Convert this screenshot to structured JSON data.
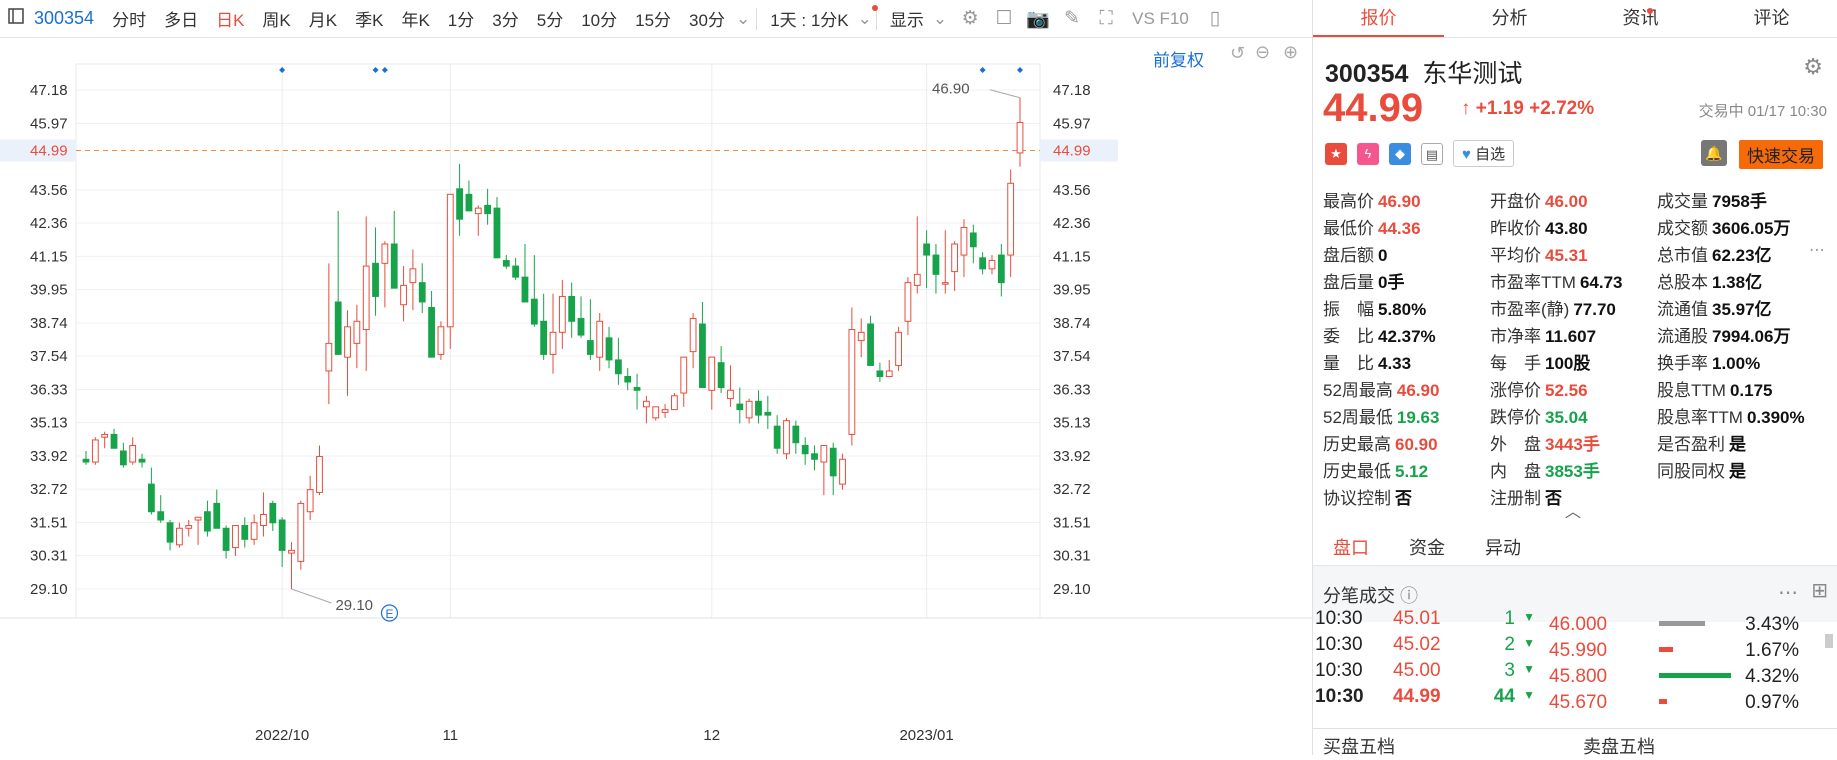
{
  "toolbar": {
    "code": "300354",
    "items": [
      "分时",
      "多日",
      "日K",
      "周K",
      "月K",
      "季K",
      "年K",
      "1分",
      "3分",
      "5分",
      "10分",
      "15分",
      "30分"
    ],
    "active": "日K",
    "range": "1天 : 1分K",
    "display": "显示",
    "vs": "VS F10"
  },
  "chart": {
    "restore": "前复权",
    "yticks": [
      "47.18",
      "45.97",
      "44.99",
      "43.56",
      "42.36",
      "41.15",
      "39.95",
      "38.74",
      "37.54",
      "36.33",
      "35.13",
      "33.92",
      "32.72",
      "31.51",
      "30.31",
      "29.10"
    ],
    "current": "44.99",
    "high_label": "46.90",
    "low_label": "29.10",
    "xticks": [
      "2022/10",
      "11",
      "12",
      "2023/01"
    ],
    "event": "E"
  },
  "chart_data": {
    "type": "candlestick",
    "y_min": 29.1,
    "y_max": 47.18,
    "candles": [
      [
        33.8,
        34.1,
        33.6,
        33.7
      ],
      [
        33.7,
        34.6,
        33.6,
        34.5
      ],
      [
        34.6,
        34.8,
        34.2,
        34.7
      ],
      [
        34.7,
        34.9,
        34.6,
        34.2
      ],
      [
        34.1,
        34.4,
        33.5,
        33.6
      ],
      [
        33.7,
        34.6,
        33.6,
        34.3
      ],
      [
        33.8,
        34.0,
        33.5,
        33.7
      ],
      [
        32.9,
        33.5,
        31.8,
        31.9
      ],
      [
        31.9,
        32.5,
        31.5,
        31.6
      ],
      [
        31.5,
        31.6,
        30.5,
        30.8
      ],
      [
        30.7,
        31.5,
        30.6,
        31.3
      ],
      [
        31.3,
        31.6,
        31.0,
        31.4
      ],
      [
        31.6,
        31.7,
        30.7,
        31.7
      ],
      [
        31.9,
        32.3,
        31.0,
        31.2
      ],
      [
        32.2,
        32.7,
        31.5,
        31.3
      ],
      [
        31.3,
        31.4,
        30.2,
        30.5
      ],
      [
        30.6,
        31.4,
        30.3,
        31.4
      ],
      [
        31.4,
        31.7,
        30.6,
        30.9
      ],
      [
        30.9,
        31.8,
        30.7,
        31.5
      ],
      [
        31.4,
        32.6,
        31.0,
        31.8
      ],
      [
        32.2,
        32.3,
        31.2,
        31.5
      ],
      [
        31.6,
        31.7,
        29.9,
        30.5
      ],
      [
        30.4,
        30.8,
        29.1,
        30.5
      ],
      [
        30.1,
        32.3,
        29.8,
        32.2
      ],
      [
        31.9,
        33.2,
        31.6,
        32.7
      ],
      [
        32.6,
        34.3,
        32.5,
        33.9
      ],
      [
        37.0,
        40.9,
        35.8,
        38.0
      ],
      [
        39.5,
        42.8,
        37.8,
        37.6
      ],
      [
        37.5,
        39.2,
        36.1,
        38.6
      ],
      [
        38.0,
        39.4,
        37.1,
        38.8
      ],
      [
        38.5,
        42.6,
        37.0,
        40.8
      ],
      [
        40.9,
        42.2,
        39.0,
        39.7
      ],
      [
        40.9,
        41.7,
        39.3,
        41.6
      ],
      [
        41.6,
        42.8,
        40.0,
        40.0
      ],
      [
        39.4,
        40.8,
        38.8,
        40.1
      ],
      [
        40.2,
        41.4,
        39.2,
        40.7
      ],
      [
        40.2,
        40.9,
        39.1,
        39.5
      ],
      [
        39.3,
        39.9,
        37.5,
        37.5
      ],
      [
        37.6,
        38.8,
        37.4,
        38.6
      ],
      [
        38.6,
        40.5,
        37.8,
        43.4
      ],
      [
        43.6,
        44.5,
        41.9,
        42.5
      ],
      [
        43.4,
        43.9,
        42.8,
        42.8
      ],
      [
        42.7,
        43.0,
        41.9,
        42.9
      ],
      [
        43.0,
        43.6,
        42.3,
        42.7
      ],
      [
        42.9,
        43.3,
        41.1,
        41.1
      ],
      [
        41.0,
        41.2,
        40.7,
        40.8
      ],
      [
        40.8,
        41.1,
        40.3,
        40.4
      ],
      [
        40.4,
        41.6,
        40.0,
        39.5
      ],
      [
        39.6,
        41.2,
        38.6,
        38.7
      ],
      [
        38.8,
        39.8,
        37.4,
        37.6
      ],
      [
        37.6,
        39.8,
        36.9,
        38.4
      ],
      [
        38.4,
        40.3,
        37.8,
        39.7
      ],
      [
        39.7,
        40.2,
        38.2,
        38.8
      ],
      [
        38.9,
        39.7,
        38.2,
        38.3
      ],
      [
        38.1,
        39.6,
        37.4,
        37.6
      ],
      [
        37.5,
        39.1,
        37.0,
        38.8
      ],
      [
        38.2,
        38.6,
        37.1,
        37.4
      ],
      [
        37.4,
        38.2,
        36.5,
        36.9
      ],
      [
        36.8,
        37.1,
        36.3,
        36.6
      ],
      [
        36.4,
        36.9,
        35.6,
        36.3
      ],
      [
        35.7,
        36.1,
        35.1,
        35.9
      ],
      [
        35.3,
        35.6,
        35.2,
        35.7
      ],
      [
        35.5,
        35.8,
        35.3,
        35.6
      ],
      [
        35.6,
        36.2,
        35.6,
        36.1
      ],
      [
        36.2,
        37.5,
        35.7,
        37.5
      ],
      [
        37.7,
        39.1,
        37.1,
        38.9
      ],
      [
        38.7,
        39.5,
        37.5,
        36.4
      ],
      [
        36.3,
        37.4,
        35.6,
        37.5
      ],
      [
        37.3,
        37.9,
        36.2,
        36.4
      ],
      [
        36.0,
        37.2,
        35.7,
        36.3
      ],
      [
        35.8,
        36.4,
        35.1,
        35.6
      ],
      [
        35.3,
        36.0,
        35.1,
        35.9
      ],
      [
        35.9,
        36.3,
        35.1,
        35.4
      ],
      [
        35.5,
        36.1,
        34.9,
        35.4
      ],
      [
        35.0,
        35.4,
        34.0,
        34.2
      ],
      [
        34.0,
        35.3,
        33.8,
        35.2
      ],
      [
        35.0,
        35.2,
        34.0,
        34.4
      ],
      [
        34.3,
        34.6,
        33.6,
        34.0
      ],
      [
        34.0,
        34.3,
        33.4,
        33.8
      ],
      [
        33.7,
        34.3,
        32.5,
        34.3
      ],
      [
        34.2,
        34.4,
        32.5,
        33.2
      ],
      [
        32.9,
        34.0,
        32.7,
        33.8
      ],
      [
        34.7,
        39.3,
        34.3,
        38.5
      ],
      [
        38.1,
        38.9,
        37.5,
        38.4
      ],
      [
        38.7,
        39.0,
        37.3,
        37.2
      ],
      [
        37.0,
        37.3,
        36.6,
        36.8
      ],
      [
        36.8,
        37.4,
        36.8,
        37.0
      ],
      [
        37.2,
        38.6,
        37.0,
        38.4
      ],
      [
        38.8,
        40.4,
        38.3,
        40.2
      ],
      [
        40.1,
        42.6,
        39.8,
        40.5
      ],
      [
        41.6,
        42.1,
        40.0,
        41.2
      ],
      [
        41.2,
        41.6,
        39.8,
        40.5
      ],
      [
        40.2,
        42.1,
        39.8,
        40.2
      ],
      [
        40.6,
        41.7,
        39.9,
        41.6
      ],
      [
        41.2,
        42.5,
        40.4,
        42.2
      ],
      [
        42.0,
        42.3,
        40.9,
        41.5
      ],
      [
        41.1,
        41.3,
        40.5,
        40.7
      ],
      [
        40.7,
        41.2,
        40.5,
        41.0
      ],
      [
        41.2,
        41.6,
        39.7,
        40.2
      ],
      [
        41.2,
        44.3,
        40.4,
        43.8
      ],
      [
        44.9,
        46.9,
        44.4,
        46.0
      ]
    ]
  },
  "right": {
    "tabs": [
      "报价",
      "分析",
      "资讯",
      "评论"
    ],
    "code": "300354",
    "name": "东华测试",
    "price": "44.99",
    "change": "+1.19",
    "pct": "+2.72%",
    "status": "交易中 01/17 10:30",
    "zixuan": "自选",
    "quick": "快速交易",
    "grid": [
      [
        [
          "最高价",
          "46.90",
          "red"
        ],
        [
          "开盘价",
          "46.00",
          "red"
        ],
        [
          "成交量",
          "7958手",
          "blk"
        ]
      ],
      [
        [
          "最低价",
          "44.36",
          "red"
        ],
        [
          "昨收价",
          "43.80",
          "blk"
        ],
        [
          "成交额",
          "3606.05万",
          "blk"
        ]
      ],
      [
        [
          "盘后额",
          "0",
          "blk"
        ],
        [
          "平均价",
          "45.31",
          "red"
        ],
        [
          "总市值",
          "62.23亿",
          "blk"
        ]
      ],
      [
        [
          "盘后量",
          "0手",
          "blk"
        ],
        [
          "市盈率TTM",
          "64.73",
          "blk"
        ],
        [
          "总股本",
          "1.38亿",
          "blk"
        ]
      ],
      [
        [
          "振　幅",
          "5.80%",
          "blk"
        ],
        [
          "市盈率(静)",
          "77.70",
          "blk"
        ],
        [
          "流通值",
          "35.97亿",
          "blk"
        ]
      ],
      [
        [
          "委　比",
          "42.37%",
          "blk"
        ],
        [
          "市净率",
          "11.607",
          "blk"
        ],
        [
          "流通股",
          "7994.06万",
          "blk"
        ]
      ],
      [
        [
          "量　比",
          "4.33",
          "blk"
        ],
        [
          "每　手",
          "100股",
          "blk"
        ],
        [
          "换手率",
          "1.00%",
          "blk"
        ]
      ],
      [
        [
          "52周最高",
          "46.90",
          "red"
        ],
        [
          "涨停价",
          "52.56",
          "red"
        ],
        [
          "股息TTM",
          "0.175",
          "blk"
        ]
      ],
      [
        [
          "52周最低",
          "19.63",
          "green"
        ],
        [
          "跌停价",
          "35.04",
          "green"
        ],
        [
          "股息率TTM",
          "0.390%",
          "blk"
        ]
      ],
      [
        [
          "历史最高",
          "60.90",
          "red"
        ],
        [
          "外　盘",
          "3443手",
          "red"
        ],
        [
          "是否盈利",
          "是",
          "blk"
        ]
      ],
      [
        [
          "历史最低",
          "5.12",
          "green"
        ],
        [
          "内　盘",
          "3853手",
          "green"
        ],
        [
          "同股同权",
          "是",
          "blk"
        ]
      ],
      [
        [
          "协议控制",
          "否",
          "blk"
        ],
        [
          "注册制",
          "否",
          "blk"
        ],
        [
          "",
          ""
        ]
      ]
    ],
    "dtabs": [
      "盘口",
      "资金",
      "异动"
    ],
    "trade_title": "分笔成交",
    "trades": [
      [
        "10:30",
        "45.01",
        "1"
      ],
      [
        "10:30",
        "45.02",
        "2"
      ],
      [
        "10:30",
        "45.00",
        "3"
      ],
      [
        "10:30",
        "44.99",
        "44"
      ]
    ],
    "levels": [
      [
        "46.000",
        "3.43%",
        "#999",
        46
      ],
      [
        "45.990",
        "1.67%",
        "#e94c3c",
        14
      ],
      [
        "45.800",
        "4.32%",
        "#17a34a",
        72
      ],
      [
        "45.670",
        "0.97%",
        "#e94c3c",
        8
      ]
    ],
    "buy5": "买盘五档",
    "sell5": "卖盘五档"
  }
}
